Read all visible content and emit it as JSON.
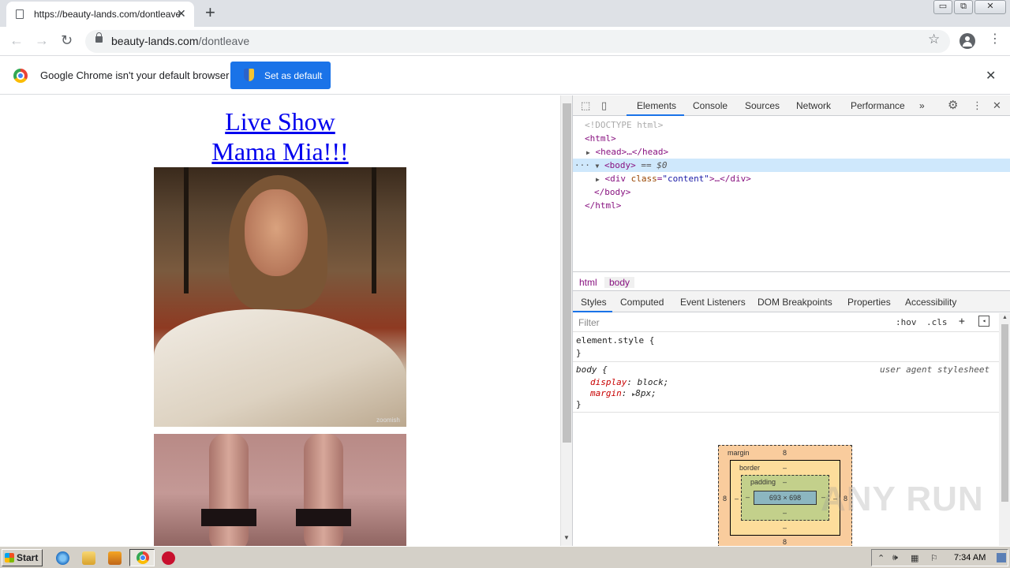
{
  "browser": {
    "tab_title": "https://beauty-lands.com/dontleave",
    "tab_close": "✕",
    "new_tab": "+",
    "window_buttons": [
      "▭",
      "⧉",
      "✕"
    ],
    "url_host": "beauty-lands.com",
    "url_path": "/dontleave",
    "nav_back": "←",
    "nav_forward": "→",
    "nav_reload": "↻",
    "star": "☆",
    "menu": "⋮"
  },
  "infobar": {
    "message": "Google Chrome isn't your default browser",
    "button_label": "Set as default",
    "close": "✕"
  },
  "page": {
    "link_line1": "Live Show",
    "link_line2": "Mama Mia!!!",
    "image1_caption": "zoomish"
  },
  "devtools": {
    "tabs": [
      "Elements",
      "Console",
      "Sources",
      "Network",
      "Performance"
    ],
    "more_tabs": "»",
    "dom": {
      "doctype": "<!DOCTYPE html>",
      "html_open": "<html>",
      "head": "<head>…</head>",
      "body_tag": "<body>",
      "body_marker": "== $0",
      "div_tag": "div",
      "div_attr": "class",
      "div_value": "\"content\"",
      "div_rest": ">…</div>",
      "body_close": "</body>",
      "html_close": "</html>",
      "ellipsis": "···"
    },
    "breadcrumbs": [
      "html",
      "body"
    ],
    "subtabs": [
      "Styles",
      "Computed",
      "Event Listeners",
      "DOM Breakpoints",
      "Properties",
      "Accessibility"
    ],
    "filter_placeholder": "Filter",
    "filter_hov": ":hov",
    "filter_cls": ".cls",
    "filter_plus": "+",
    "styles": {
      "element_style": "element.style {",
      "close_brace": "}",
      "body_selector": "body {",
      "ua_label": "user agent stylesheet",
      "prop1_name": "display",
      "prop1_value": "block;",
      "prop2_name": "margin",
      "prop2_value": "8px;"
    },
    "box_model": {
      "margin_label": "margin",
      "margin_top": "8",
      "margin_left": "8",
      "margin_right": "8",
      "margin_bottom": "8",
      "border_label": "border",
      "border_value": "–",
      "padding_label": "padding",
      "padding_value": "–",
      "content": "693 × 698"
    }
  },
  "watermark": "ANY RUN",
  "taskbar": {
    "start_label": "Start",
    "clock": "7:34 AM"
  },
  "colors": {
    "accent": "#1a73e8",
    "link": "#0000ee",
    "tag": "#881280"
  }
}
